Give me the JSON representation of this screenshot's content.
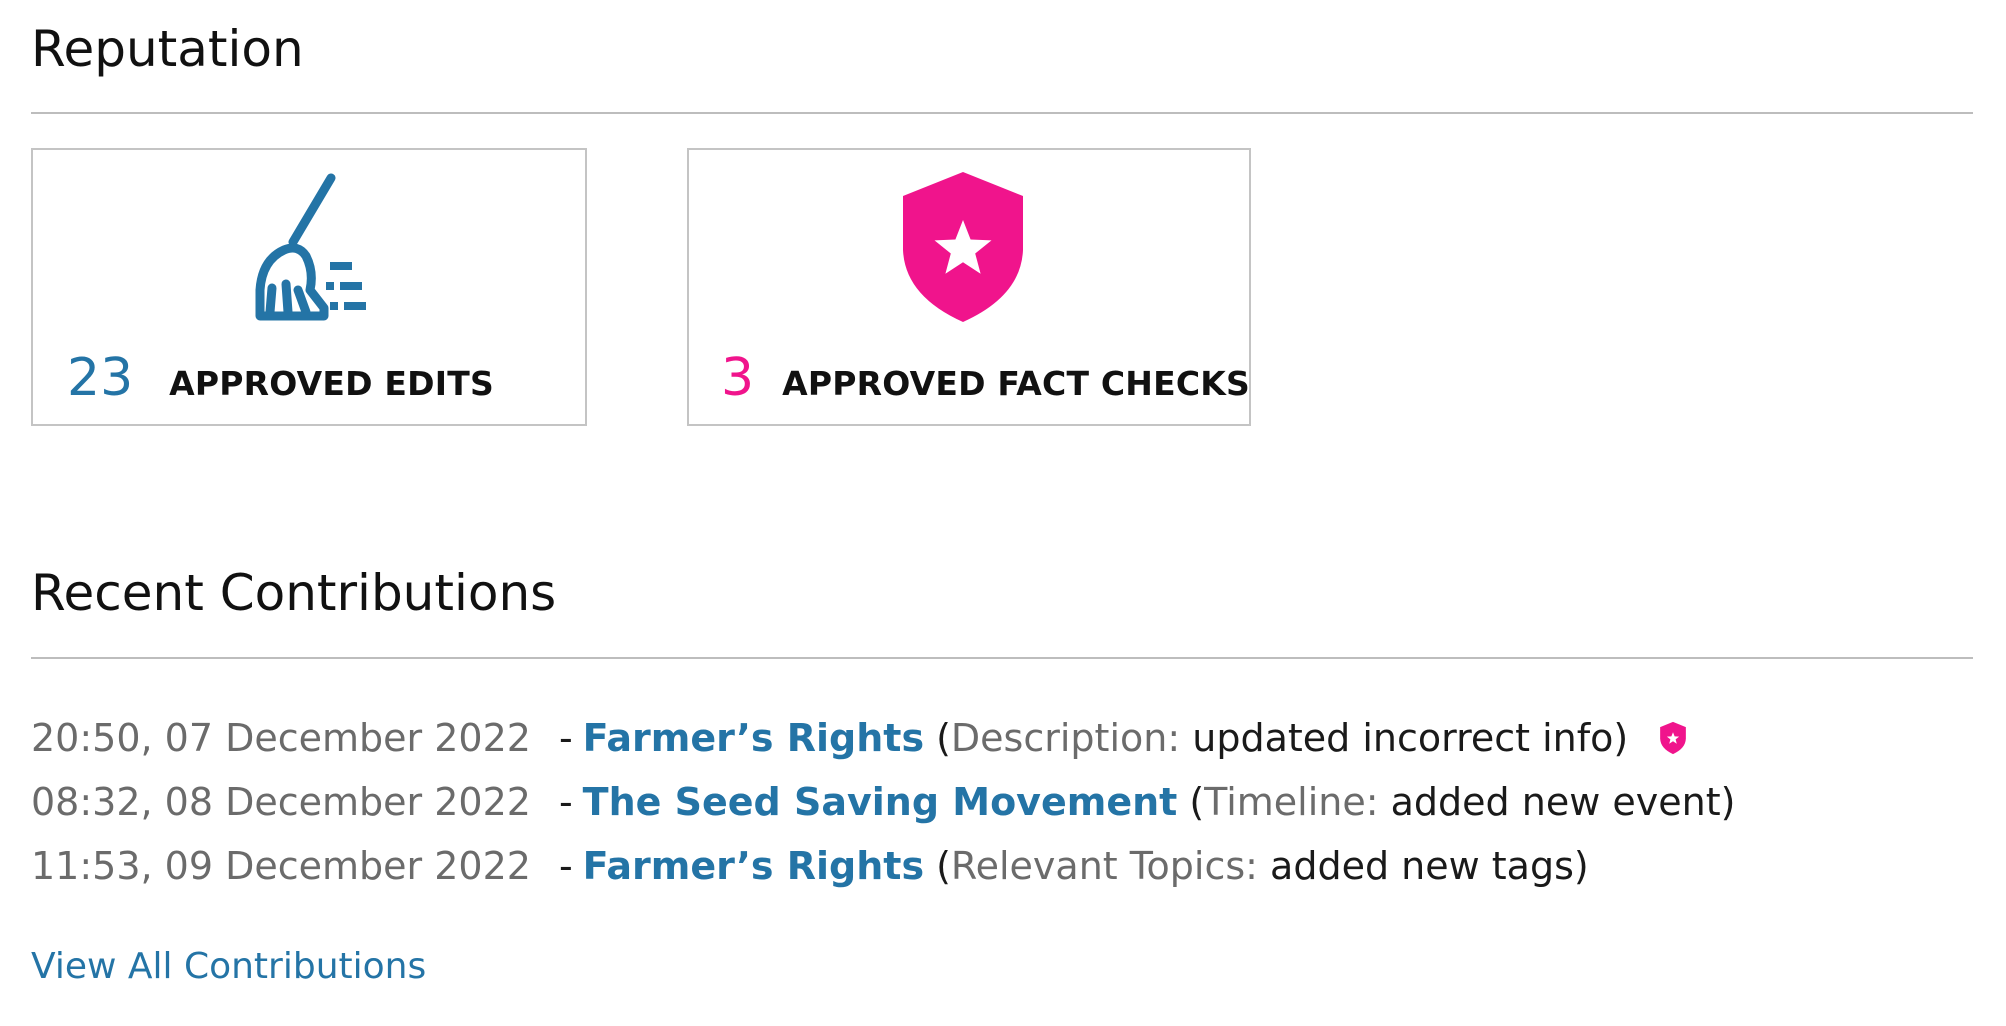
{
  "reputation": {
    "title": "Reputation",
    "cards": [
      {
        "icon": "broom-icon",
        "count": "23",
        "label": "APPROVED EDITS",
        "color": "#2474a6"
      },
      {
        "icon": "shield-star-icon",
        "count": "3",
        "label": "APPROVED FACT CHECKS",
        "color": "#f0148c"
      }
    ]
  },
  "contributions": {
    "title": "Recent Contributions",
    "items": [
      {
        "timestamp": "20:50, 07 December 2022",
        "dash": "-",
        "article": "Farmer’s Rights",
        "open": "(",
        "field": "Description:",
        "change": "updated incorrect info",
        "close": ")",
        "badge": "shield-star-icon"
      },
      {
        "timestamp": "08:32, 08 December 2022",
        "dash": "-",
        "article": "The Seed Saving Movement",
        "open": "(",
        "field": "Timeline:",
        "change": "added new event",
        "close": ")"
      },
      {
        "timestamp": "11:53, 09 December 2022",
        "dash": "-",
        "article": "Farmer’s Rights",
        "open": "(",
        "field": "Relevant Topics:",
        "change": "added new tags",
        "close": ")"
      }
    ],
    "view_all": "View All Contributions"
  },
  "colors": {
    "link": "#2474a6",
    "accent_pink": "#f0148c",
    "muted_text": "#6b6b6b",
    "divider": "#bdbdbd"
  }
}
